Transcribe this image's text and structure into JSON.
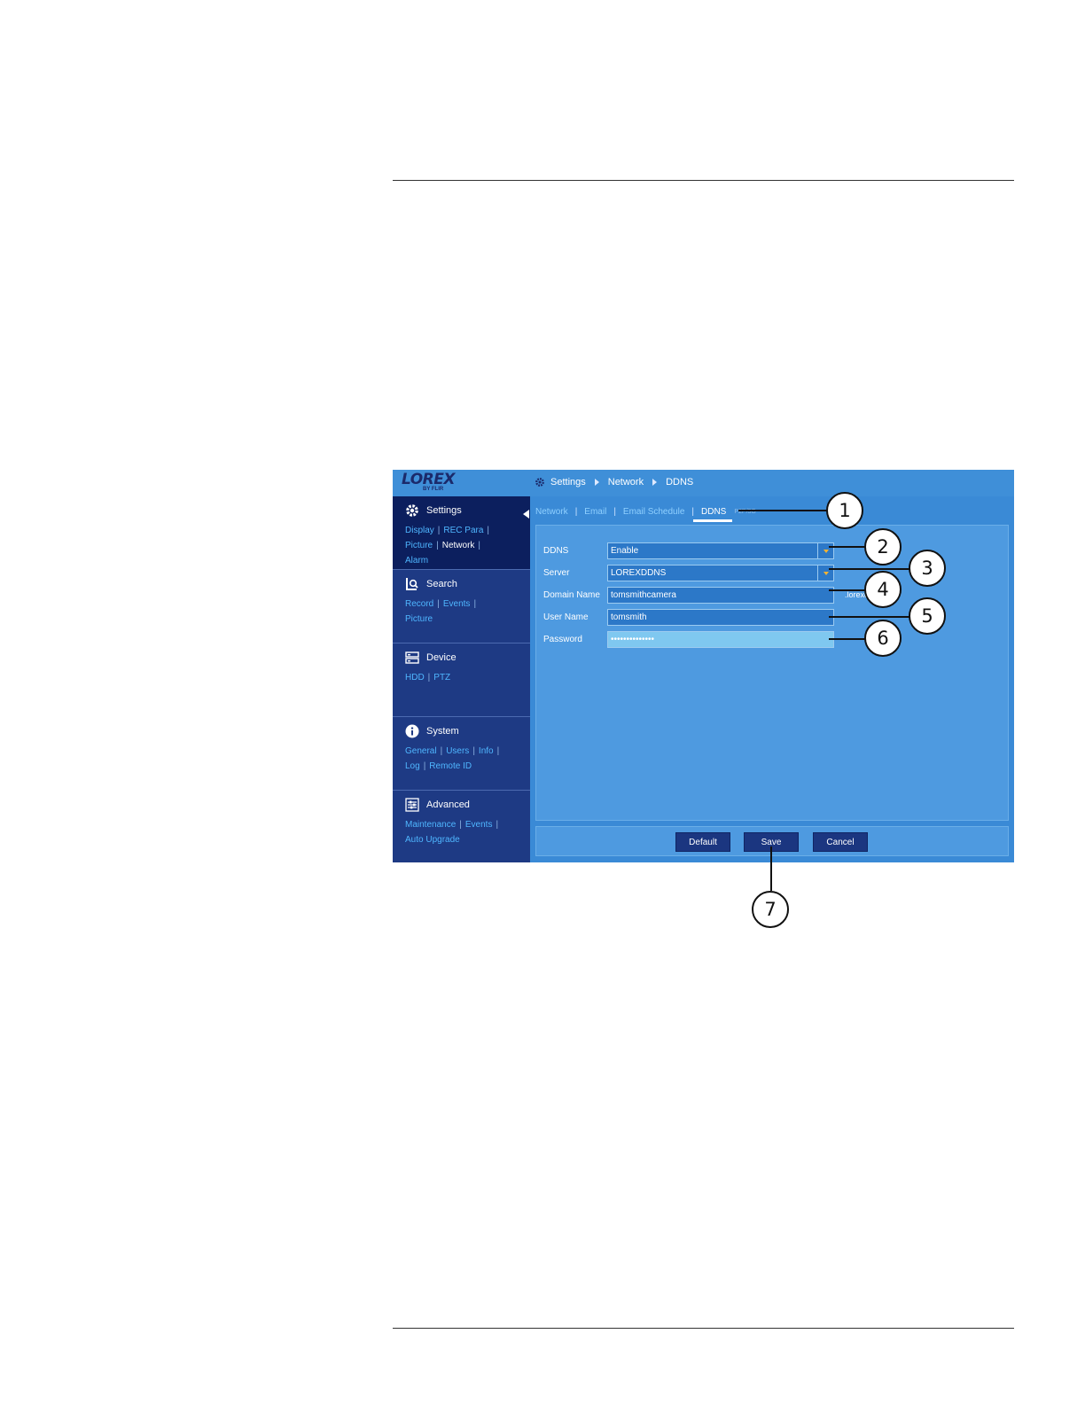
{
  "brand": {
    "logo_text": "LOREX",
    "logo_sub": "BY FLIR"
  },
  "breadcrumb": [
    "Settings",
    "Network",
    "DDNS"
  ],
  "sidebar": {
    "sections": [
      {
        "title": "Settings",
        "icon": "gear-icon",
        "links": [
          "Display",
          "REC Para",
          "Picture",
          "Network",
          "Alarm"
        ],
        "current": "Network"
      },
      {
        "title": "Search",
        "icon": "search-icon",
        "links": [
          "Record",
          "Events",
          "Picture"
        ]
      },
      {
        "title": "Device",
        "icon": "device-icon",
        "links": [
          "HDD",
          "PTZ"
        ]
      },
      {
        "title": "System",
        "icon": "info-icon",
        "links": [
          "General",
          "Users",
          "Info",
          "Log",
          "Remote ID"
        ]
      },
      {
        "title": "Advanced",
        "icon": "sliders-icon",
        "links": [
          "Maintenance",
          "Events",
          "Auto Upgrade"
        ]
      }
    ]
  },
  "tabs": {
    "items": [
      "Network",
      "Email",
      "Email Schedule",
      "DDNS"
    ],
    "active": "DDNS",
    "ghost": "P2P/3G"
  },
  "form": {
    "ddns": {
      "label": "DDNS",
      "value": "Enable"
    },
    "server": {
      "label": "Server",
      "value": "LOREXDDNS"
    },
    "domain": {
      "label": "Domain Name",
      "value": "tomsmithcamera",
      "suffix": ".lorexd"
    },
    "username": {
      "label": "User Name",
      "value": "tomsmith"
    },
    "password": {
      "label": "Password",
      "value": "••••••••••••••"
    }
  },
  "buttons": {
    "default": "Default",
    "save": "Save",
    "cancel": "Cancel"
  },
  "callouts": [
    "1",
    "2",
    "3",
    "4",
    "5",
    "6",
    "7"
  ],
  "colors": {
    "screen_bg": "#3a8ad6",
    "sidebar_bg": "#1e3a84",
    "link": "#4fb6ff",
    "dropdown_arrow": "#f2b233"
  }
}
